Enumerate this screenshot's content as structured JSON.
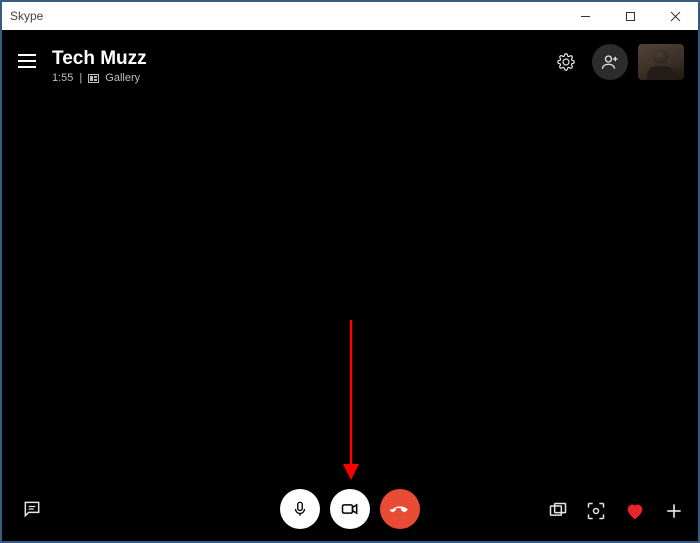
{
  "window": {
    "title": "Skype"
  },
  "header": {
    "call_title": "Tech Muzz",
    "duration": "1:55",
    "separator": "|",
    "gallery_label": "Gallery"
  },
  "annotation": {
    "arrow_color": "#ff0000"
  },
  "colors": {
    "end_call": "#e94b35",
    "heart": "#e9222d"
  }
}
